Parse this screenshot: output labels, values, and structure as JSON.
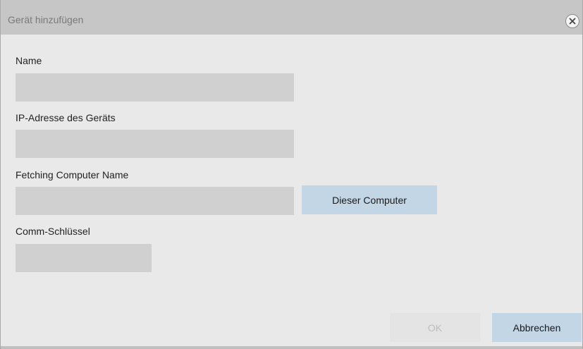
{
  "dialog": {
    "title": "Gerät hinzufügen"
  },
  "form": {
    "name_label": "Name",
    "name_value": "",
    "ip_label": "IP-Adresse des Geräts",
    "ip_value": "",
    "computer_label": "Fetching Computer Name",
    "computer_value": "",
    "this_computer_button": "Dieser Computer",
    "comm_key_label": "Comm-Schlüssel",
    "comm_key_value": ""
  },
  "footer": {
    "ok_label": "OK",
    "ok_enabled": false,
    "cancel_label": "Abbrechen"
  },
  "icons": {
    "close": "close-icon"
  },
  "colors": {
    "titlebar": "#c6c6c6",
    "dialog_bg": "#e9e9e9",
    "input_bg": "#d0d0d0",
    "button_accent": "#c3d6e6"
  }
}
